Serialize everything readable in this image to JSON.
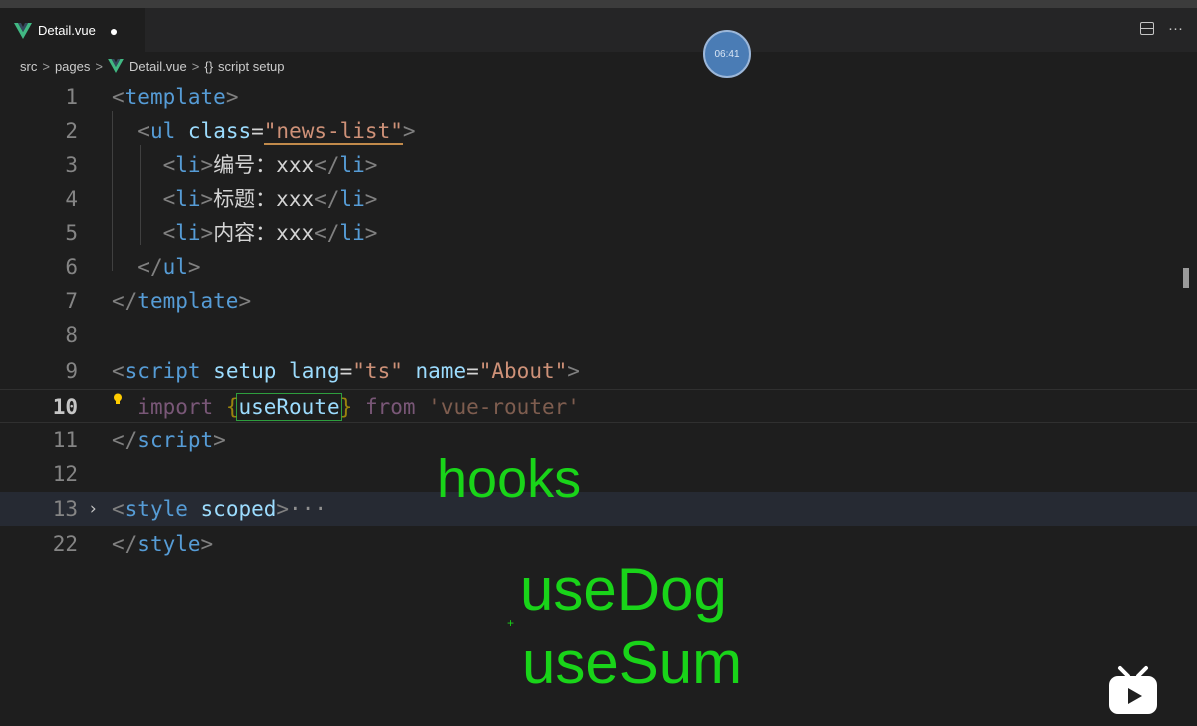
{
  "tab": {
    "filename": "Detail.vue",
    "dirty_marker": "●",
    "more": "···"
  },
  "breadcrumb": {
    "p1": "src",
    "p2": "pages",
    "p3": "Detail.vue",
    "braces": "{}",
    "p4": "script setup",
    "sep": ">"
  },
  "timer": "06:41",
  "lines": [
    {
      "n": "1"
    },
    {
      "n": "2"
    },
    {
      "n": "3"
    },
    {
      "n": "4"
    },
    {
      "n": "5"
    },
    {
      "n": "6"
    },
    {
      "n": "7"
    },
    {
      "n": "8"
    },
    {
      "n": "9"
    },
    {
      "n": "10"
    },
    {
      "n": "11"
    },
    {
      "n": "12"
    },
    {
      "n": "13"
    },
    {
      "n": "22"
    }
  ],
  "code": {
    "template_tag": "template",
    "ul": "ul",
    "class_attr": "class",
    "class_val": "\"news-list\"",
    "li": "li",
    "li1_text": "编号：xxx",
    "li2_text": "标题：xxx",
    "li3_text": "内容：xxx",
    "script_tag": "script",
    "setup": "setup",
    "lang_attr": "lang",
    "lang_val": "\"ts\"",
    "name_attr": "name",
    "name_val": "\"About\"",
    "import_kw": "import",
    "use_route": "useRoute",
    "from_kw": "from",
    "module": "'vue-router'",
    "style_tag": "style",
    "scoped": "scoped",
    "ellipsis": "···"
  },
  "annotations": {
    "hooks": "hooks",
    "use_dog": "useDog",
    "use_sum": "useSum"
  },
  "colors": {
    "annotation": "#19d419",
    "background": "#1e1e1e"
  },
  "icons": [
    "vue-icon",
    "split-editor-icon",
    "lightbulb-icon",
    "chevron-right-icon",
    "bilibili-icon"
  ]
}
